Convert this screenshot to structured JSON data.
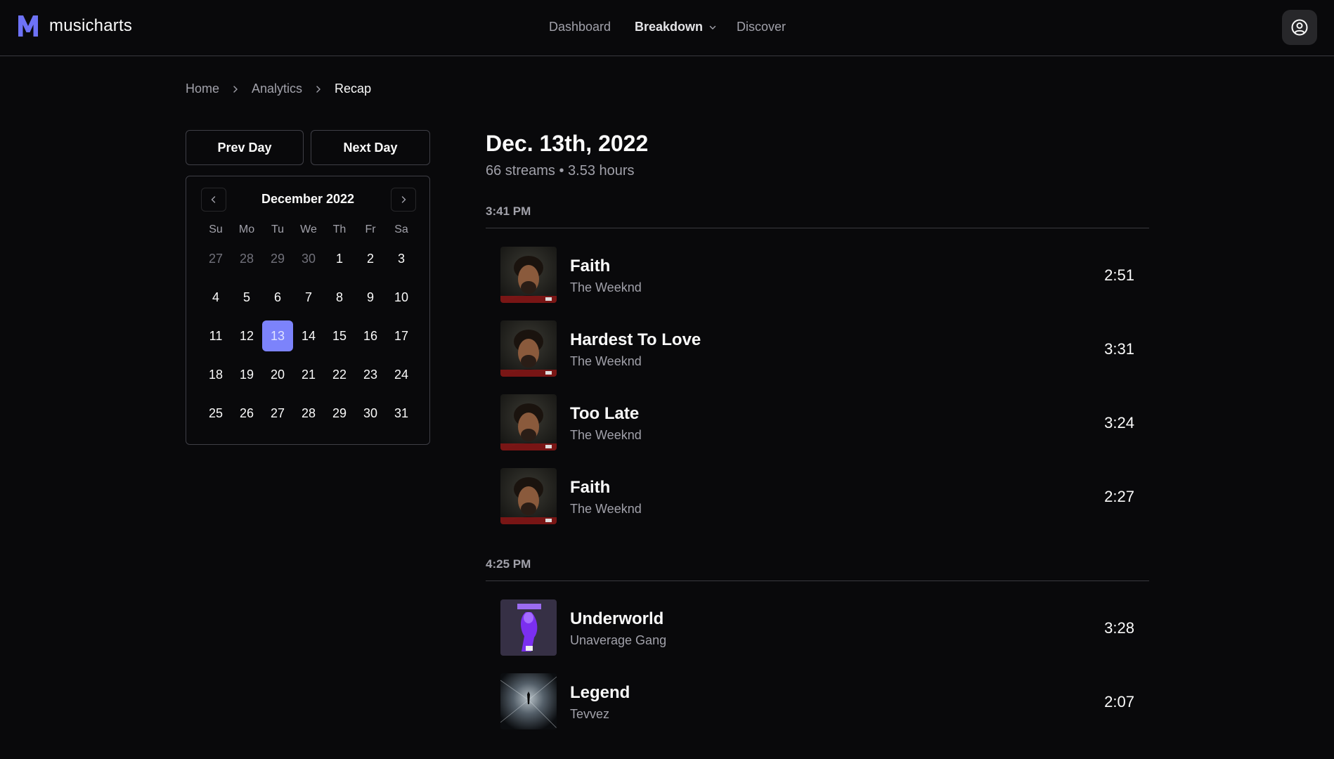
{
  "app": {
    "name": "musicharts",
    "logo_letter": "M",
    "accent": "#6d72f6"
  },
  "nav": {
    "items": [
      {
        "label": "Dashboard"
      },
      {
        "label": "Breakdown"
      },
      {
        "label": "Discover"
      }
    ],
    "active": "Breakdown",
    "profile_icon": "user-circle-icon"
  },
  "breadcrumb": [
    "Home",
    "Analytics",
    "Recap"
  ],
  "day_nav": {
    "prev": "Prev Day",
    "next": "Next Day"
  },
  "calendar": {
    "month": "December 2022",
    "weekdays": [
      "Su",
      "Mo",
      "Tu",
      "We",
      "Th",
      "Fr",
      "Sa"
    ],
    "weeks": [
      [
        "27",
        "28",
        "29",
        "30",
        "1",
        "2",
        "3"
      ],
      [
        "4",
        "5",
        "6",
        "7",
        "8",
        "9",
        "10"
      ],
      [
        "11",
        "12",
        "13",
        "14",
        "15",
        "16",
        "17"
      ],
      [
        "18",
        "19",
        "20",
        "21",
        "22",
        "23",
        "24"
      ],
      [
        "25",
        "26",
        "27",
        "28",
        "29",
        "30",
        "31"
      ]
    ],
    "outside_days_first_week": 4,
    "selected": "13",
    "selected_color": "#7c83fb"
  },
  "recap": {
    "title": "Dec. 13th, 2022",
    "summary": "66 streams • 3.53 hours",
    "sessions": [
      {
        "time": "3:41 PM",
        "tracks": [
          {
            "name": "Faith",
            "artist": "The Weeknd",
            "duration": "2:51",
            "art": "after-hours"
          },
          {
            "name": "Hardest To Love",
            "artist": "The Weeknd",
            "duration": "3:31",
            "art": "after-hours"
          },
          {
            "name": "Too Late",
            "artist": "The Weeknd",
            "duration": "3:24",
            "art": "after-hours"
          },
          {
            "name": "Faith",
            "artist": "The Weeknd",
            "duration": "2:27",
            "art": "after-hours"
          }
        ]
      },
      {
        "time": "4:25 PM",
        "tracks": [
          {
            "name": "Underworld",
            "artist": "Unaverage Gang",
            "duration": "3:28",
            "art": "purple"
          },
          {
            "name": "Legend",
            "artist": "Tevvez",
            "duration": "2:07",
            "art": "dark-burst"
          }
        ]
      }
    ]
  }
}
